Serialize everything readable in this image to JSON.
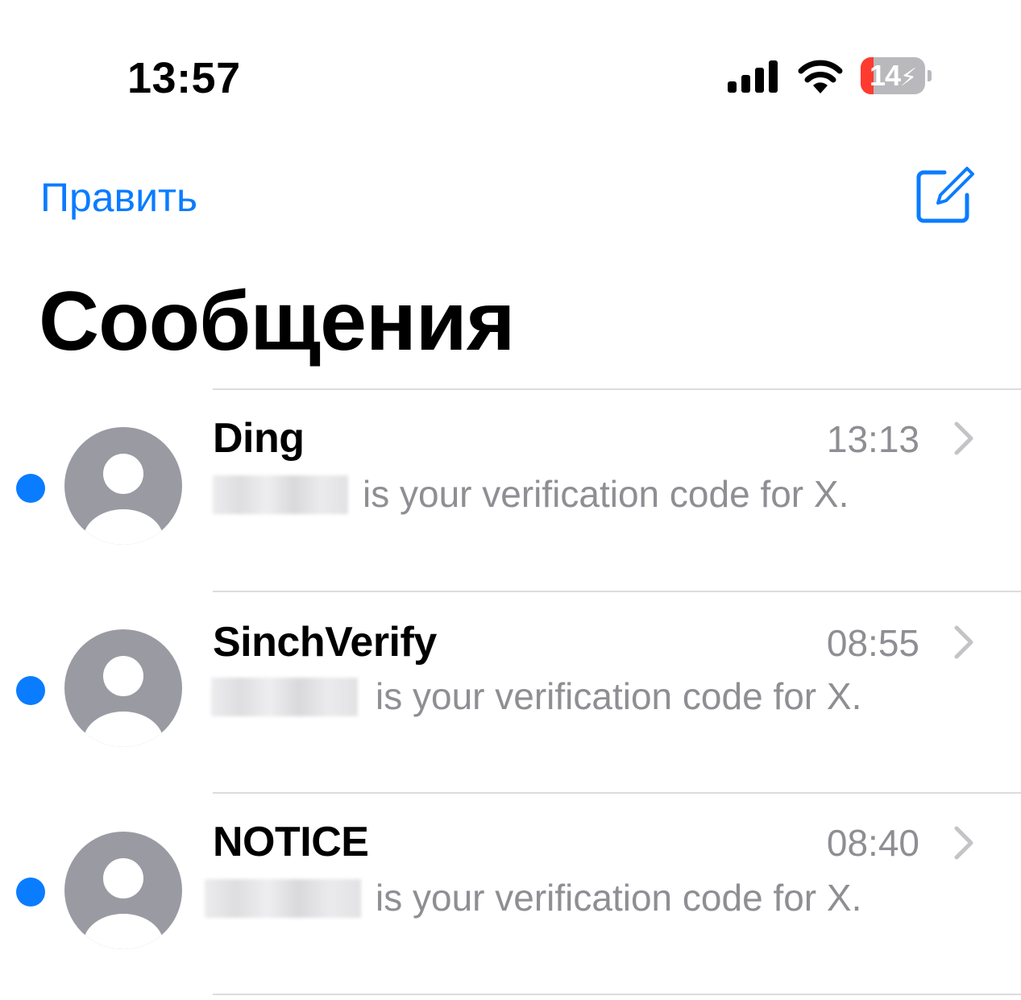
{
  "status_bar": {
    "time": "13:57",
    "battery_level": "14",
    "battery_fraction": 0.14,
    "icons": [
      "cellular-signal-icon",
      "wifi-icon",
      "battery-charging-icon"
    ]
  },
  "nav": {
    "edit_label": "Править",
    "compose_icon": "compose-icon"
  },
  "title": "Сообщения",
  "colors": {
    "accent": "#0a7cff",
    "secondary_text": "#8e8e93",
    "avatar": "#9a9aa3",
    "battery_low": "#ff3b30"
  },
  "conversations": [
    {
      "sender": "Ding",
      "time": "13:13",
      "preview": "is your verification code for X.",
      "unread": true
    },
    {
      "sender": "SinchVerify",
      "time": "08:55",
      "preview": "is your verification code for X.",
      "unread": true
    },
    {
      "sender": "NOTICE",
      "time": "08:40",
      "preview": "is your verification code for X.",
      "unread": true
    }
  ]
}
